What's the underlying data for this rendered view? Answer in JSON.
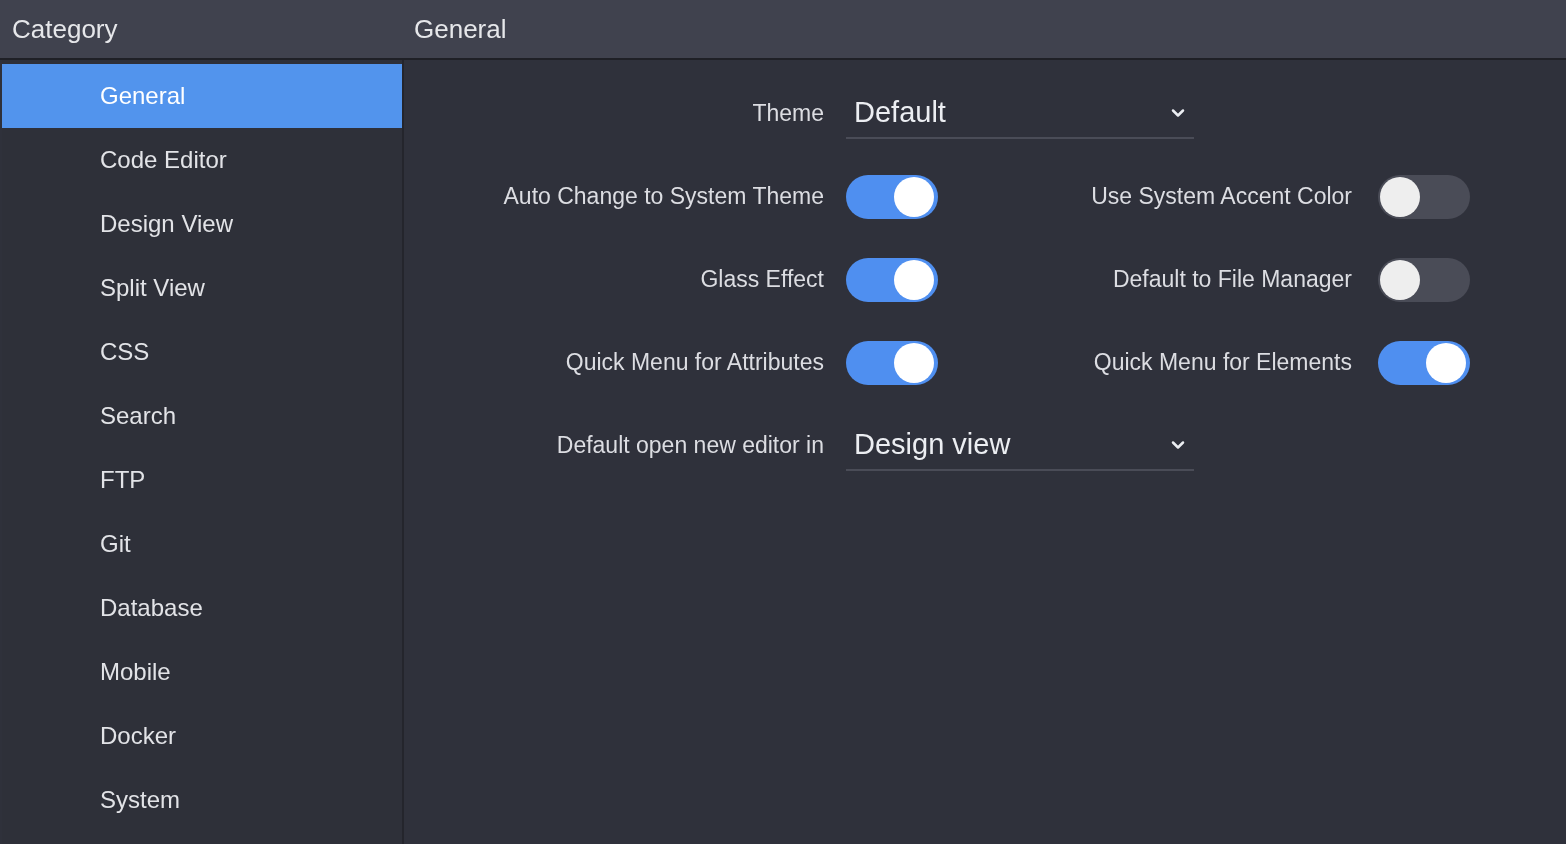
{
  "header": {
    "category_title": "Category",
    "section_title": "General"
  },
  "sidebar": {
    "items": [
      {
        "label": "General",
        "selected": true
      },
      {
        "label": "Code Editor",
        "selected": false
      },
      {
        "label": "Design View",
        "selected": false
      },
      {
        "label": "Split View",
        "selected": false
      },
      {
        "label": "CSS",
        "selected": false
      },
      {
        "label": "Search",
        "selected": false
      },
      {
        "label": "FTP",
        "selected": false
      },
      {
        "label": "Git",
        "selected": false
      },
      {
        "label": "Database",
        "selected": false
      },
      {
        "label": "Mobile",
        "selected": false
      },
      {
        "label": "Docker",
        "selected": false
      },
      {
        "label": "System",
        "selected": false
      }
    ]
  },
  "settings": [
    {
      "kind": "select",
      "label": "Theme",
      "value": "Default"
    },
    {
      "kind": "toggles",
      "items": [
        {
          "label": "Auto Change to System Theme",
          "on": true
        },
        {
          "label": "Use System Accent Color",
          "on": false
        }
      ]
    },
    {
      "kind": "toggles",
      "items": [
        {
          "label": "Glass Effect",
          "on": true
        },
        {
          "label": "Default to File Manager",
          "on": false
        }
      ]
    },
    {
      "kind": "toggles",
      "items": [
        {
          "label": "Quick Menu for Attributes",
          "on": true
        },
        {
          "label": "Quick Menu for Elements",
          "on": true
        }
      ]
    },
    {
      "kind": "select",
      "label": "Default open new editor in",
      "value": "Design view"
    }
  ]
}
